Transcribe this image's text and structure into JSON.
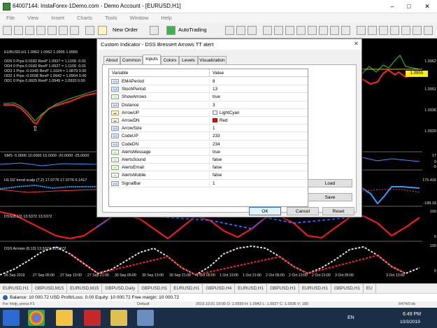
{
  "window": {
    "title": "64007144: InstaForex-1Demo.com - Demo Account - [EURUSD,H1]"
  },
  "menu": [
    "File",
    "View",
    "Insert",
    "Charts",
    "Tools",
    "Window",
    "Help"
  ],
  "toolbar": {
    "new_order": "New Order",
    "autotrading": "AutoTrading"
  },
  "chart": {
    "symbol_line": "EURUSD,H1  1.0962 1.0962 1.0955 1.0955",
    "ods_lines": [
      "OD5 0 Prps 0.0182 RevP  1.0927 = 1.1109  -0.01",
      "OD4 0 Prps 0.0182 RevP  1.0927 = 1.1109  -0.01",
      "OD3 1 Prps -0.0145 RevP 1.1024 = 1.0879  0.00",
      "OD2 1 Prps -0.0038 RevP 1.0942 = 1.0904  0.00",
      "OD1 0 Prps 0.0025 RevP  1.0945 = 1.0920  0.00"
    ],
    "current_price": "1.0955",
    "price_scale": [
      "1.0962",
      "1.0951",
      "1.0936",
      "1.0920"
    ],
    "sms_label": "SMS -5.0000 10.0000 15.0000 -20.0000 -25.0000",
    "sms_scale": [
      "17",
      "0",
      "-5"
    ],
    "trend_label": "H1 DZ trend scalp (7,2) 17.0776 17.0776 6.1417",
    "trend_scale": [
      "175.416",
      "-188.18"
    ],
    "dss_label": "DSS(8,13) 13.5372 13.5372",
    "dss_scale": [
      "100",
      "0"
    ],
    "dss_arrows_label": "DSS Arrows (8,13) 13.5372 13.5372",
    "dss_arrows_scale": [
      "100",
      "0"
    ],
    "time_labels": [
      "26 Sep 2019",
      "27 Sep 05:00",
      "27 Sep 13:00",
      "27 Sep 21:00",
      "30 Sep 05:00",
      "30 Sep 13:00",
      "30 Sep 21:00",
      "1 Oct 05:00",
      "1 Oct 13:00",
      "1 Oct 21:00",
      "2 Oct 05:00",
      "2 Oct 13:00",
      "2 Oct 21:00",
      "3 Oct 05:00",
      "3 Oct 13:00"
    ]
  },
  "tabs": [
    "EURUSD,H1",
    "GBPUSD,M15",
    "EURUSD,M15",
    "GBPUSD,Daily",
    "GBPUSD,H1",
    "EURUSD,H1",
    "GBPUSD,H4",
    "EURUSD,H1",
    "GBPUSD,H1",
    "EURUSD,H1",
    "GBPUSD,H1",
    "EU"
  ],
  "balance": "Balance: 10 000.72 USD  Profit/Loss: 0.00  Equity: 10 000.72  Free margin: 10 000.72",
  "status": {
    "help": "For Help, press F1",
    "profile": "Default",
    "bar": "2019.10.01 19:00  O: 1.0930  H: 1.0942  L: 1.0927  C: 1.0936  V: 180",
    "traffic": "6474/3 kb"
  },
  "taskbar": {
    "lang": "EN",
    "time": "6:49 PM",
    "date": "10/3/2019"
  },
  "dialog": {
    "title": "Custom Indicator - DSS Bressert Arrows TT alert",
    "tabs": [
      "About",
      "Common",
      "Inputs",
      "Colors",
      "Levels",
      "Visualization"
    ],
    "selected_tab": "Inputs",
    "columns": [
      "Variable",
      "Value"
    ],
    "rows": [
      {
        "name": "EMAPeriod",
        "value": "8",
        "kind": "num"
      },
      {
        "name": "StochPeriod",
        "value": "13",
        "kind": "num"
      },
      {
        "name": "ShowArrows",
        "value": "true",
        "kind": "bool"
      },
      {
        "name": "Distance",
        "value": "3",
        "kind": "num"
      },
      {
        "name": "ArrowUP",
        "value": "LightCyan",
        "kind": "col",
        "swatch": "#e0ffff"
      },
      {
        "name": "ArrowDN",
        "value": "Red",
        "kind": "col",
        "swatch": "#ff0000"
      },
      {
        "name": "ArrowSize",
        "value": "1",
        "kind": "num"
      },
      {
        "name": "CodeUP",
        "value": "233",
        "kind": "num"
      },
      {
        "name": "CodeDN",
        "value": "234",
        "kind": "num"
      },
      {
        "name": "AlertsMessage",
        "value": "true",
        "kind": "bool"
      },
      {
        "name": "AlertsSound",
        "value": "false",
        "kind": "bool"
      },
      {
        "name": "AlertsEmail",
        "value": "false",
        "kind": "bool"
      },
      {
        "name": "AlertsMobile",
        "value": "false",
        "kind": "bool"
      },
      {
        "name": "SignalBar",
        "value": "1",
        "kind": "num"
      }
    ],
    "load_label": "Load",
    "save_label": "Save",
    "ok_label": "OK",
    "cancel_label": "Cancel",
    "reset_label": "Reset"
  }
}
